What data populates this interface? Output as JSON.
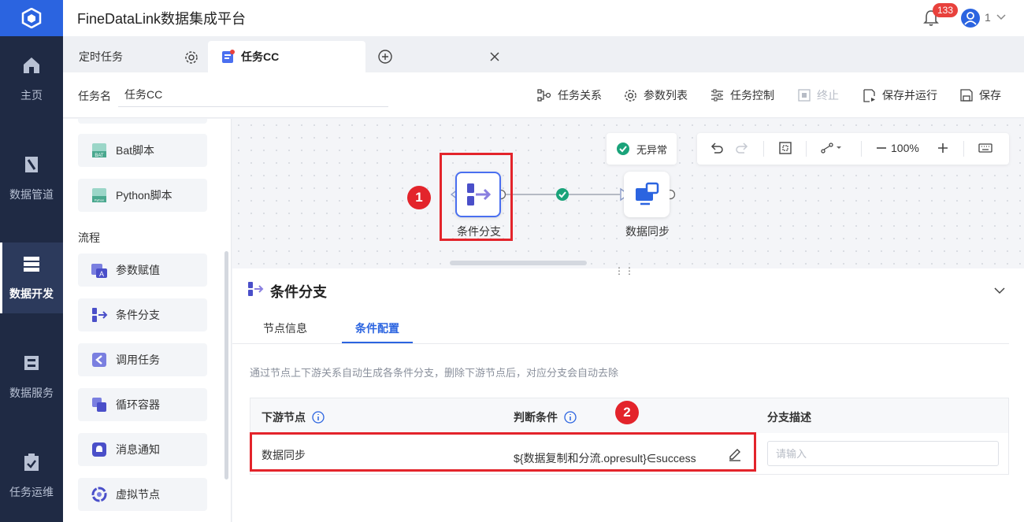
{
  "app": {
    "title": "FineDataLink数据集成平台"
  },
  "user": {
    "notifications": "133",
    "name": "1"
  },
  "nav": [
    {
      "label": "主页",
      "icon": "home-icon"
    },
    {
      "label": "数据管道",
      "icon": "pipeline-icon"
    },
    {
      "label": "数据开发",
      "icon": "dev-icon",
      "active": true
    },
    {
      "label": "数据服务",
      "icon": "service-icon"
    },
    {
      "label": "任务运维",
      "icon": "ops-icon"
    }
  ],
  "tabs": [
    {
      "label": "定时任务"
    },
    {
      "label": "任务CC",
      "active": true
    }
  ],
  "toolbar": {
    "taskname_label": "任务名",
    "taskname_value": "任务CC",
    "relations": "任务关系",
    "params": "参数列表",
    "control": "任务控制",
    "stop": "终止",
    "save_run": "保存并运行",
    "save": "保存"
  },
  "components": {
    "items_top": [
      "Bat脚本",
      "Python脚本"
    ],
    "section": "流程",
    "flow_items": [
      "参数赋值",
      "条件分支",
      "调用任务",
      "循环容器",
      "消息通知",
      "虚拟节点"
    ]
  },
  "canvas": {
    "status": "无异常",
    "zoom": "100%",
    "nodes": [
      {
        "label": "条件分支",
        "selected": true
      },
      {
        "label": "数据同步"
      }
    ],
    "annotations": [
      "1",
      "2"
    ]
  },
  "panel": {
    "title": "条件分支",
    "tabs": [
      "节点信息",
      "条件配置"
    ],
    "active_tab": "条件配置",
    "hint": "通过节点上下游关系自动生成各条件分支，删除下游节点后，对应分支会自动去除",
    "columns": [
      "下游节点",
      "判断条件",
      "分支描述"
    ],
    "rows": [
      {
        "node": "数据同步",
        "condition": "${数据复制和分流.opresult}∈success",
        "desc_placeholder": "请输入"
      }
    ]
  },
  "colors": {
    "accent": "#2b64e0",
    "nav_bg": "#1f2a44",
    "annotation": "#e3242b",
    "success": "#1aa37a"
  }
}
